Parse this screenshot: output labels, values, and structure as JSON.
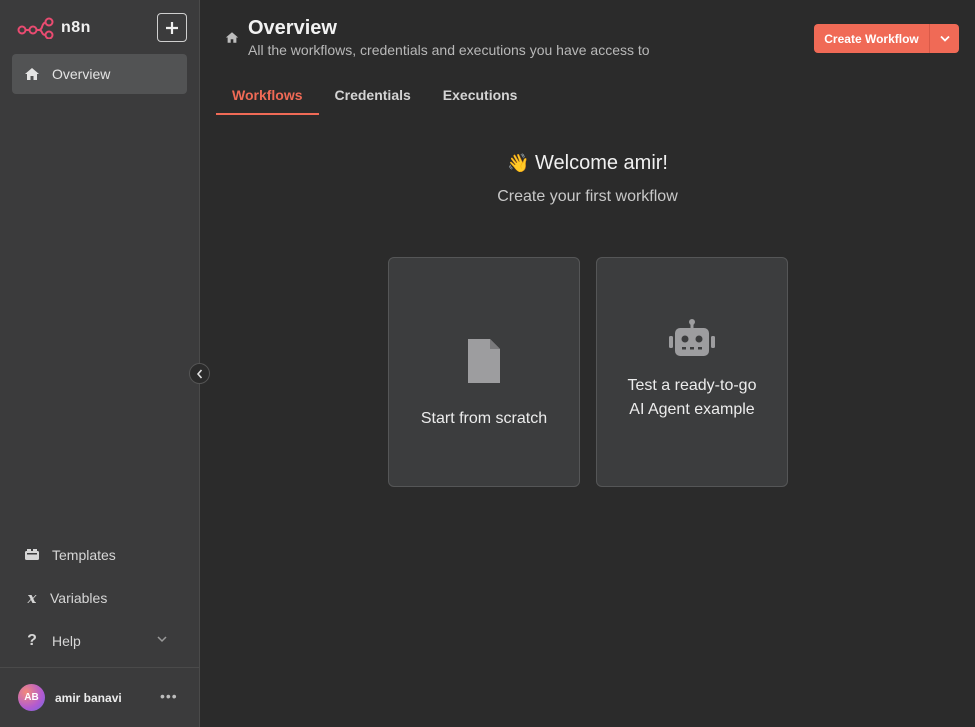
{
  "app": {
    "logo_text": "n8n"
  },
  "sidebar": {
    "new_label": "+",
    "overview_label": "Overview",
    "templates_label": "Templates",
    "variables_label": "Variables",
    "help_label": "Help",
    "user": {
      "initials": "AB",
      "name": "amir banavi",
      "more": "•••"
    }
  },
  "header": {
    "title": "Overview",
    "subtitle": "All the workflows, credentials and executions you have access to",
    "create_label": "Create Workflow"
  },
  "tabs": [
    {
      "label": "Workflows",
      "active": true
    },
    {
      "label": "Credentials",
      "active": false
    },
    {
      "label": "Executions",
      "active": false
    }
  ],
  "main": {
    "welcome_emoji": "👋",
    "welcome": "Welcome amir!",
    "welcome_sub": "Create your first workflow",
    "cards": [
      {
        "line1": "Start from scratch",
        "line2": ""
      },
      {
        "line1": "Test a ready-to-go",
        "line2": "AI Agent example"
      }
    ]
  },
  "colors": {
    "accent": "#f06a56",
    "sidebar_bg": "#3b3b3c",
    "main_bg": "#2b2b2b"
  }
}
